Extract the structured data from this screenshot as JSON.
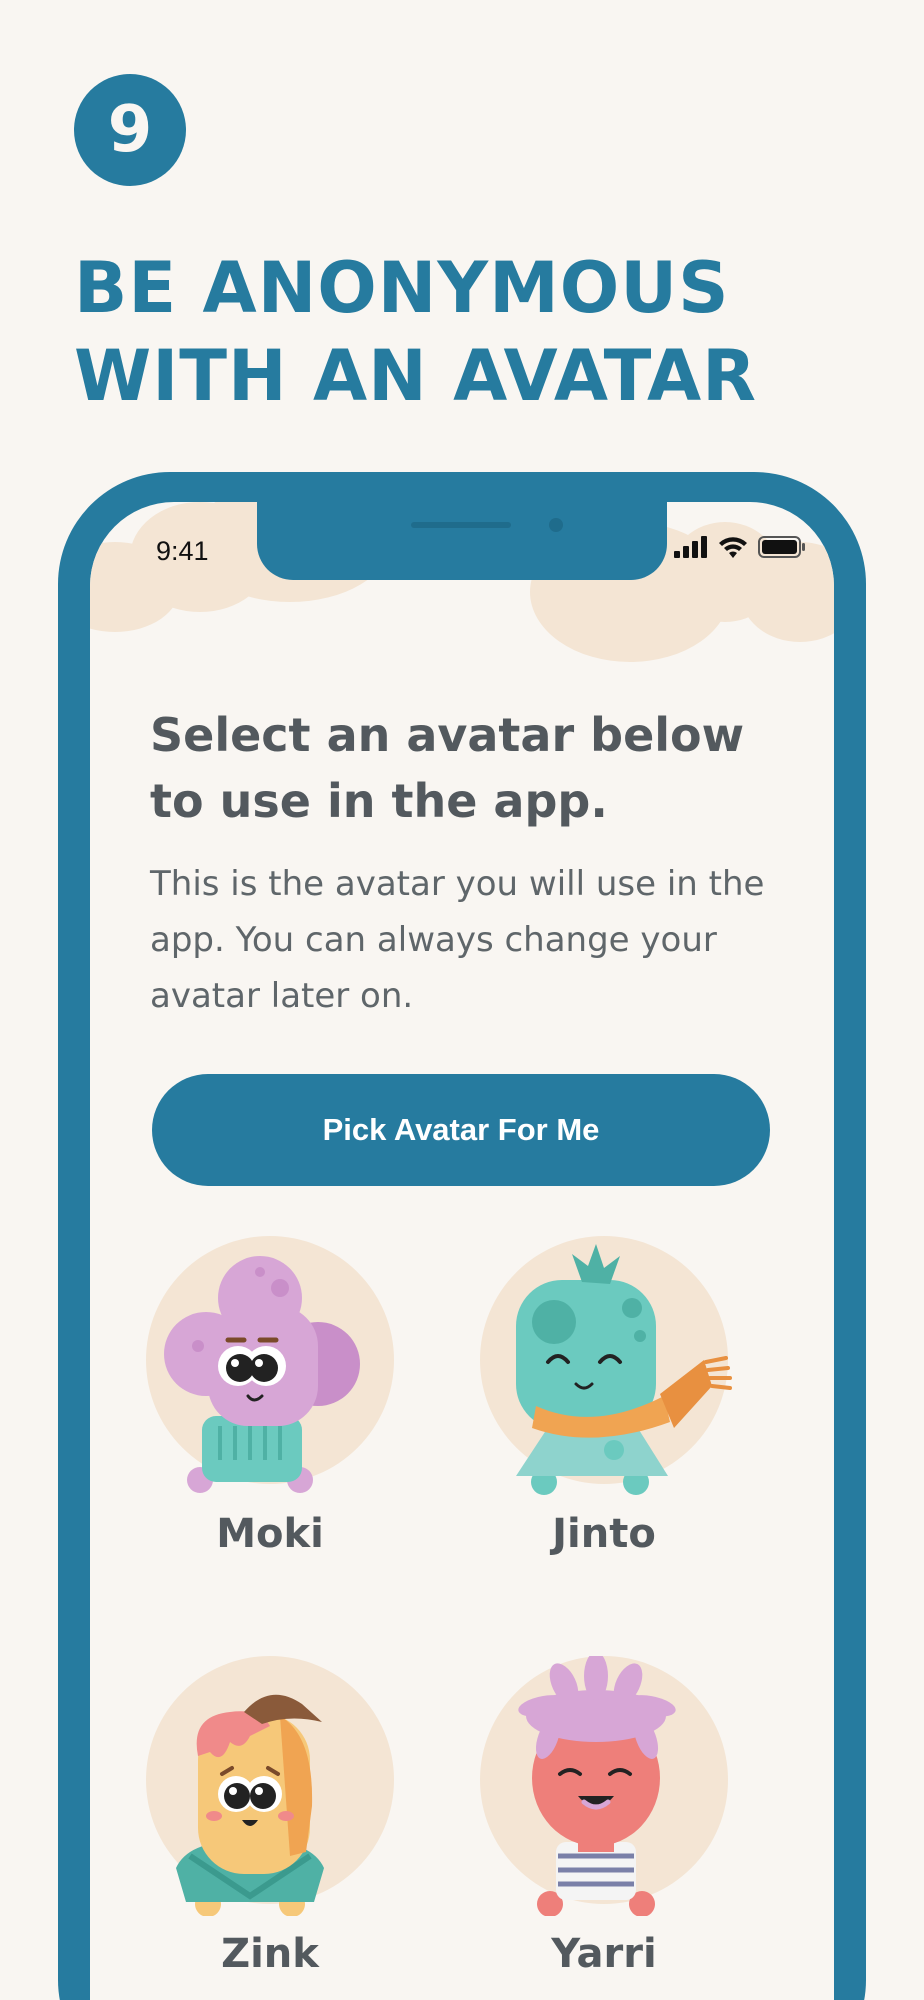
{
  "step": {
    "number": "9"
  },
  "headline": {
    "line1": "BE ANONYMOUS",
    "line2": "WITH AN AVATAR"
  },
  "status_bar": {
    "time": "9:41",
    "icons": [
      "signal-icon",
      "wifi-icon",
      "battery-icon"
    ]
  },
  "screen": {
    "title_line1": "Select an avatar below",
    "title_line2": "to use in the app.",
    "description": "This is the avatar you will use in the app. You can always change your avatar later on.",
    "pick_button_label": "Pick Avatar For Me"
  },
  "avatars": [
    {
      "name": "Moki"
    },
    {
      "name": "Jinto"
    },
    {
      "name": "Zink"
    },
    {
      "name": "Yarri"
    }
  ],
  "colors": {
    "brand": "#267b9f",
    "background": "#f9f6f2",
    "cloud": "#f4e5d4",
    "text_dark": "#53595e"
  }
}
